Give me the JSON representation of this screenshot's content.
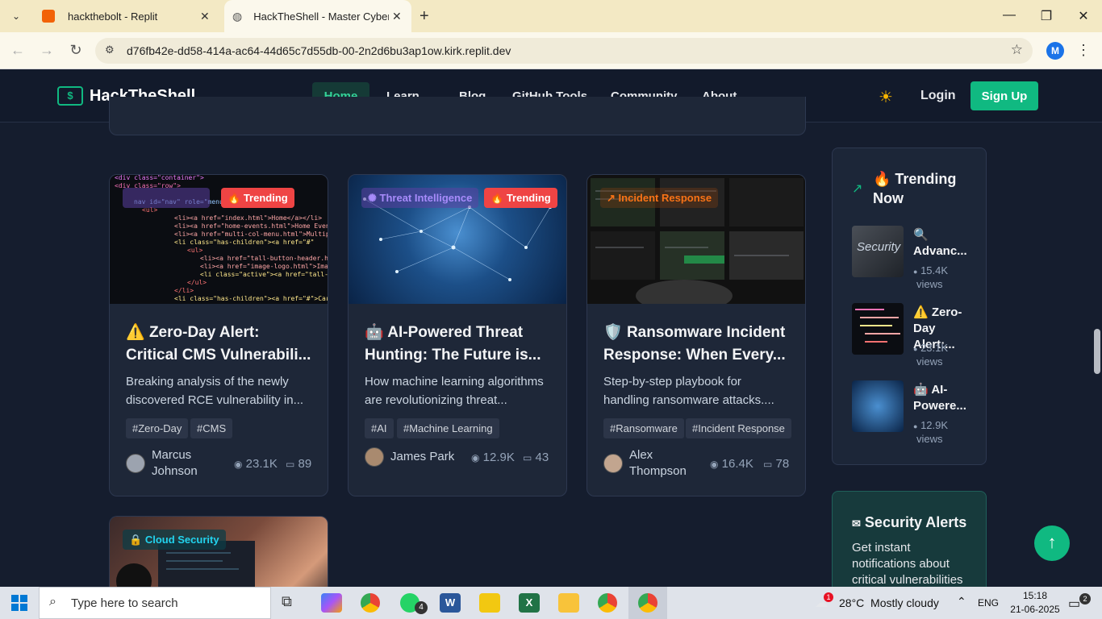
{
  "browser": {
    "tabs": [
      {
        "title": "hackthebolt - Replit"
      },
      {
        "title": "HackTheShell - Master Cyberse"
      }
    ],
    "url": "d76fb42e-dd58-414a-ac64-44d65c7d55db-00-2n2d6bu3ap1ow.kirk.replit.dev",
    "profile_initial": "M"
  },
  "site": {
    "logo_text": "HackTheShell",
    "logo_symbol": "$",
    "nav": [
      "Home",
      "Learn",
      "Blog",
      "GitHub Tools",
      "Community",
      "About"
    ],
    "login": "Login",
    "signup": "Sign Up"
  },
  "cards": [
    {
      "category": "",
      "badge": "Trending",
      "emoji": "⚠️",
      "title_line1": "Zero-Day Alert:",
      "title_line2": "Critical CMS Vulnerabili...",
      "desc_line1": "Breaking analysis of the newly",
      "desc_line2": "discovered RCE vulnerability in...",
      "tags": [
        "#Zero-Day",
        "#CMS"
      ],
      "author_first": "Marcus",
      "author_last": "Johnson",
      "views": "23.1K",
      "comments": "89"
    },
    {
      "category": "Threat Intelligence",
      "badge": "Trending",
      "emoji": "🤖",
      "title_line1": "AI-Powered Threat",
      "title_line2": "Hunting: The Future is...",
      "desc_line1": "How machine learning algorithms",
      "desc_line2": "are revolutionizing threat...",
      "tags": [
        "#AI",
        "#Machine Learning"
      ],
      "author": "James Park",
      "views": "12.9K",
      "comments": "43"
    },
    {
      "category": "Incident Response",
      "emoji": "🛡️",
      "title_line1": "Ransomware Incident",
      "title_line2": "Response: When Every...",
      "desc_line1": "Step-by-step playbook for",
      "desc_line2": "handling ransomware attacks....",
      "tags": [
        "#Ransomware",
        "#Incident Response"
      ],
      "author_first": "Alex",
      "author_last": "Thompson",
      "views": "16.4K",
      "comments": "78"
    },
    {
      "category": "Cloud Security"
    }
  ],
  "trending": {
    "heading_line1": "🔥 Trending",
    "heading_line2": "Now",
    "items": [
      {
        "emoji": "🔍",
        "title": "Advanc...",
        "views": "15.4K",
        "views_label": "views"
      },
      {
        "emoji": "⚠️",
        "title_line1": "Zero-",
        "title_line2": "Day Alert:...",
        "views": "23.1K",
        "views_label": "views"
      },
      {
        "emoji": "🤖",
        "title_line1": "AI-",
        "title_line2": "Powere...",
        "views": "12.9K",
        "views_label": "views"
      }
    ]
  },
  "alerts": {
    "heading": "Security Alerts",
    "text_line1": "Get instant",
    "text_line2": "notifications about",
    "text_line3": "critical vulnerabilities"
  },
  "taskbar": {
    "search_placeholder": "Type here to search",
    "whatsapp_badge": "4",
    "weather_badge": "1",
    "weather": "28°C  Mostly cloudy",
    "lang": "ENG",
    "time": "15:18",
    "date": "21-06-2025",
    "notif_count": "2"
  },
  "colors": {
    "accent": "#10b981",
    "bg": "#151d2e",
    "trending": "#ef4444"
  }
}
